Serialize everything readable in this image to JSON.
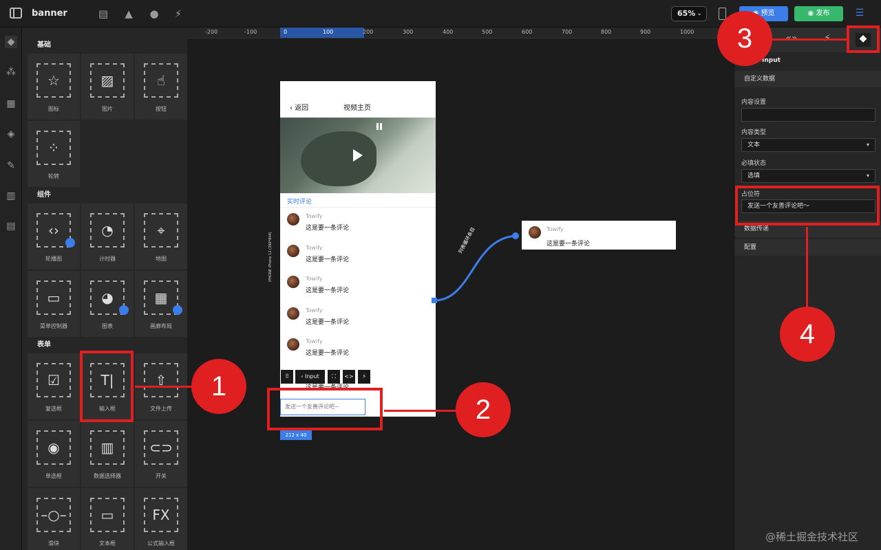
{
  "topbar": {
    "app_title": "banner",
    "zoom": "65%",
    "preview_label": "预览",
    "publish_label": "发布"
  },
  "components": {
    "cut_top": [
      "",
      "",
      ""
    ],
    "sections": [
      {
        "title": "基础"
      },
      {
        "title": "组件"
      },
      {
        "title": "表单"
      }
    ],
    "basic": [
      "图标",
      "图片",
      "按钮",
      "轮转"
    ],
    "widgets": [
      "轮播图",
      "计时器",
      "地图",
      "菜单控制器",
      "图表",
      "画廊布局"
    ],
    "forms": [
      "复选框",
      "输入框",
      "文件上传",
      "单选框",
      "数据选择器",
      "开关",
      "滑块",
      "文本框",
      "公式输入框"
    ]
  },
  "ruler": {
    "ticks": [
      "-200",
      "-100",
      "0",
      "100",
      "200",
      "300",
      "400",
      "500",
      "600",
      "700",
      "800",
      "900",
      "1000"
    ]
  },
  "canvas": {
    "device_label": "IPHONE   iPhone 12 (390*844)",
    "phone": {
      "back": "返回",
      "title": "视频主页",
      "live_comments": "实时评论",
      "comments": [
        {
          "name": "Towify",
          "text": "这是要一条评论"
        },
        {
          "name": "Towify",
          "text": "这是要一条评论"
        },
        {
          "name": "Towify",
          "text": "这是要一条评论"
        },
        {
          "name": "Towify",
          "text": "这是要一条评论"
        },
        {
          "name": "Towify",
          "text": "这是要一条评论"
        },
        {
          "name": "",
          "text": "这是要一条评论"
        }
      ],
      "input_placeholder": "发送一个友善评论吧~"
    },
    "toolbar": {
      "component_name": "Input"
    },
    "selection_size": "212 x 40",
    "loop_label": "列表循环条目",
    "loop_card": {
      "name": "Towify",
      "text": "这是要一条评论"
    }
  },
  "right_panel": {
    "component_name": "Input",
    "custom_data": "自定义数据",
    "content_setting_label": "内容设置",
    "content_type_label": "内容类型",
    "content_type_value": "文本",
    "required_label": "必填状态",
    "required_value": "选填",
    "placeholder_label": "占位符",
    "placeholder_value": "发送一个友善评论吧～",
    "data_pass": "数据传递",
    "config": "配置"
  },
  "annotations": [
    "1",
    "2",
    "3",
    "4"
  ],
  "watermark": "@稀土掘金技术社区",
  "colors": {
    "accent": "#3b7de9",
    "publish": "#37b86d",
    "annotation": "#e02020"
  }
}
